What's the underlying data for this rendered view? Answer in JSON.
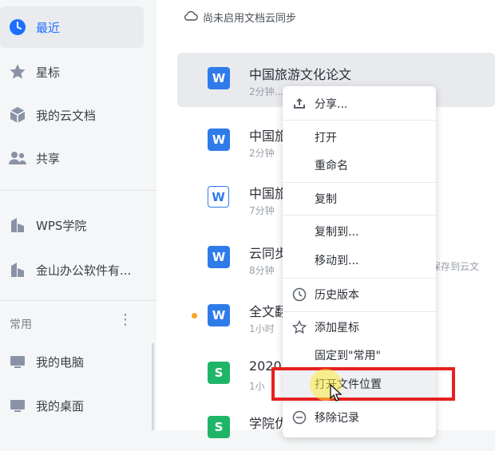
{
  "sidebar": {
    "items": [
      {
        "label": "最近",
        "icon": "clock-icon"
      },
      {
        "label": "星标",
        "icon": "star-icon"
      },
      {
        "label": "我的云文档",
        "icon": "cube-icon"
      },
      {
        "label": "共享",
        "icon": "people-icon"
      },
      {
        "label": "WPS学院",
        "icon": "building-icon"
      },
      {
        "label": "金山办公软件有...",
        "icon": "building-icon"
      },
      {
        "label": "我的电脑",
        "icon": "computer-icon"
      },
      {
        "label": "我的桌面",
        "icon": "desktop-icon"
      }
    ],
    "section_title": "常用",
    "section_more": "⋮"
  },
  "sync_status": "尚未启用文档云同步",
  "files": [
    {
      "name": "中国旅游文化论文",
      "meta": "2分钟..."
    },
    {
      "name": "中国旅",
      "meta": "2分钟"
    },
    {
      "name": "中国旅",
      "meta": "7分钟"
    },
    {
      "name": "云同步",
      "meta": "8分钟"
    },
    {
      "name": "全文翻",
      "meta": "1小时"
    },
    {
      "name": "2020",
      "meta": "1小"
    },
    {
      "name": "学院优",
      "meta": ""
    }
  ],
  "file_extra_text": "保存到云文",
  "context_menu": {
    "share": "分享...",
    "open": "打开",
    "rename": "重命名",
    "copy": "复制",
    "copy_to": "复制到...",
    "move_to": "移动到...",
    "history": "历史版本",
    "add_star": "添加星标",
    "pin": "固定到\"常用\"",
    "open_location": "打开文件位置",
    "remove_record": "移除记录"
  },
  "colors": {
    "accent": "#1e6fff",
    "highlight_box": "#e62020",
    "word_icon": "#2f7bea",
    "sheet_icon": "#1fb568"
  }
}
